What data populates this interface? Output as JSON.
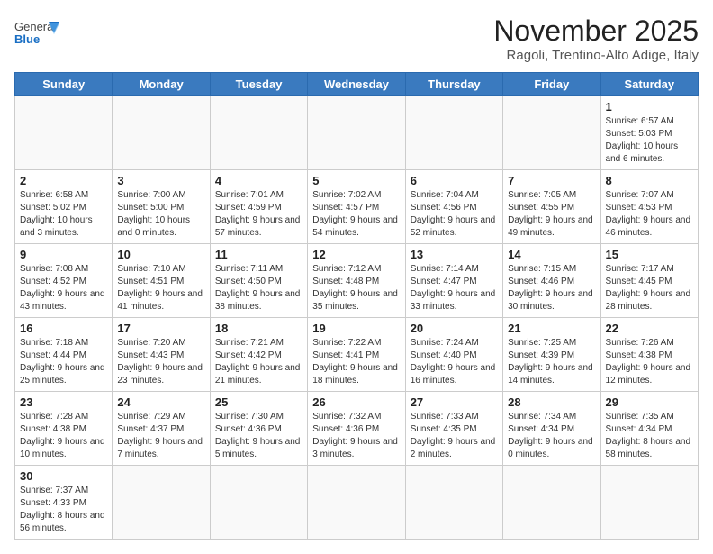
{
  "header": {
    "logo_general": "General",
    "logo_blue": "Blue",
    "title": "November 2025",
    "subtitle": "Ragoli, Trentino-Alto Adige, Italy"
  },
  "weekdays": [
    "Sunday",
    "Monday",
    "Tuesday",
    "Wednesday",
    "Thursday",
    "Friday",
    "Saturday"
  ],
  "weeks": [
    [
      {
        "day": "",
        "info": ""
      },
      {
        "day": "",
        "info": ""
      },
      {
        "day": "",
        "info": ""
      },
      {
        "day": "",
        "info": ""
      },
      {
        "day": "",
        "info": ""
      },
      {
        "day": "",
        "info": ""
      },
      {
        "day": "1",
        "info": "Sunrise: 6:57 AM\nSunset: 5:03 PM\nDaylight: 10 hours\nand 6 minutes."
      }
    ],
    [
      {
        "day": "2",
        "info": "Sunrise: 6:58 AM\nSunset: 5:02 PM\nDaylight: 10 hours\nand 3 minutes."
      },
      {
        "day": "3",
        "info": "Sunrise: 7:00 AM\nSunset: 5:00 PM\nDaylight: 10 hours\nand 0 minutes."
      },
      {
        "day": "4",
        "info": "Sunrise: 7:01 AM\nSunset: 4:59 PM\nDaylight: 9 hours\nand 57 minutes."
      },
      {
        "day": "5",
        "info": "Sunrise: 7:02 AM\nSunset: 4:57 PM\nDaylight: 9 hours\nand 54 minutes."
      },
      {
        "day": "6",
        "info": "Sunrise: 7:04 AM\nSunset: 4:56 PM\nDaylight: 9 hours\nand 52 minutes."
      },
      {
        "day": "7",
        "info": "Sunrise: 7:05 AM\nSunset: 4:55 PM\nDaylight: 9 hours\nand 49 minutes."
      },
      {
        "day": "8",
        "info": "Sunrise: 7:07 AM\nSunset: 4:53 PM\nDaylight: 9 hours\nand 46 minutes."
      }
    ],
    [
      {
        "day": "9",
        "info": "Sunrise: 7:08 AM\nSunset: 4:52 PM\nDaylight: 9 hours\nand 43 minutes."
      },
      {
        "day": "10",
        "info": "Sunrise: 7:10 AM\nSunset: 4:51 PM\nDaylight: 9 hours\nand 41 minutes."
      },
      {
        "day": "11",
        "info": "Sunrise: 7:11 AM\nSunset: 4:50 PM\nDaylight: 9 hours\nand 38 minutes."
      },
      {
        "day": "12",
        "info": "Sunrise: 7:12 AM\nSunset: 4:48 PM\nDaylight: 9 hours\nand 35 minutes."
      },
      {
        "day": "13",
        "info": "Sunrise: 7:14 AM\nSunset: 4:47 PM\nDaylight: 9 hours\nand 33 minutes."
      },
      {
        "day": "14",
        "info": "Sunrise: 7:15 AM\nSunset: 4:46 PM\nDaylight: 9 hours\nand 30 minutes."
      },
      {
        "day": "15",
        "info": "Sunrise: 7:17 AM\nSunset: 4:45 PM\nDaylight: 9 hours\nand 28 minutes."
      }
    ],
    [
      {
        "day": "16",
        "info": "Sunrise: 7:18 AM\nSunset: 4:44 PM\nDaylight: 9 hours\nand 25 minutes."
      },
      {
        "day": "17",
        "info": "Sunrise: 7:20 AM\nSunset: 4:43 PM\nDaylight: 9 hours\nand 23 minutes."
      },
      {
        "day": "18",
        "info": "Sunrise: 7:21 AM\nSunset: 4:42 PM\nDaylight: 9 hours\nand 21 minutes."
      },
      {
        "day": "19",
        "info": "Sunrise: 7:22 AM\nSunset: 4:41 PM\nDaylight: 9 hours\nand 18 minutes."
      },
      {
        "day": "20",
        "info": "Sunrise: 7:24 AM\nSunset: 4:40 PM\nDaylight: 9 hours\nand 16 minutes."
      },
      {
        "day": "21",
        "info": "Sunrise: 7:25 AM\nSunset: 4:39 PM\nDaylight: 9 hours\nand 14 minutes."
      },
      {
        "day": "22",
        "info": "Sunrise: 7:26 AM\nSunset: 4:38 PM\nDaylight: 9 hours\nand 12 minutes."
      }
    ],
    [
      {
        "day": "23",
        "info": "Sunrise: 7:28 AM\nSunset: 4:38 PM\nDaylight: 9 hours\nand 10 minutes."
      },
      {
        "day": "24",
        "info": "Sunrise: 7:29 AM\nSunset: 4:37 PM\nDaylight: 9 hours\nand 7 minutes."
      },
      {
        "day": "25",
        "info": "Sunrise: 7:30 AM\nSunset: 4:36 PM\nDaylight: 9 hours\nand 5 minutes."
      },
      {
        "day": "26",
        "info": "Sunrise: 7:32 AM\nSunset: 4:36 PM\nDaylight: 9 hours\nand 3 minutes."
      },
      {
        "day": "27",
        "info": "Sunrise: 7:33 AM\nSunset: 4:35 PM\nDaylight: 9 hours\nand 2 minutes."
      },
      {
        "day": "28",
        "info": "Sunrise: 7:34 AM\nSunset: 4:34 PM\nDaylight: 9 hours\nand 0 minutes."
      },
      {
        "day": "29",
        "info": "Sunrise: 7:35 AM\nSunset: 4:34 PM\nDaylight: 8 hours\nand 58 minutes."
      }
    ],
    [
      {
        "day": "30",
        "info": "Sunrise: 7:37 AM\nSunset: 4:33 PM\nDaylight: 8 hours\nand 56 minutes."
      },
      {
        "day": "",
        "info": ""
      },
      {
        "day": "",
        "info": ""
      },
      {
        "day": "",
        "info": ""
      },
      {
        "day": "",
        "info": ""
      },
      {
        "day": "",
        "info": ""
      },
      {
        "day": "",
        "info": ""
      }
    ]
  ]
}
